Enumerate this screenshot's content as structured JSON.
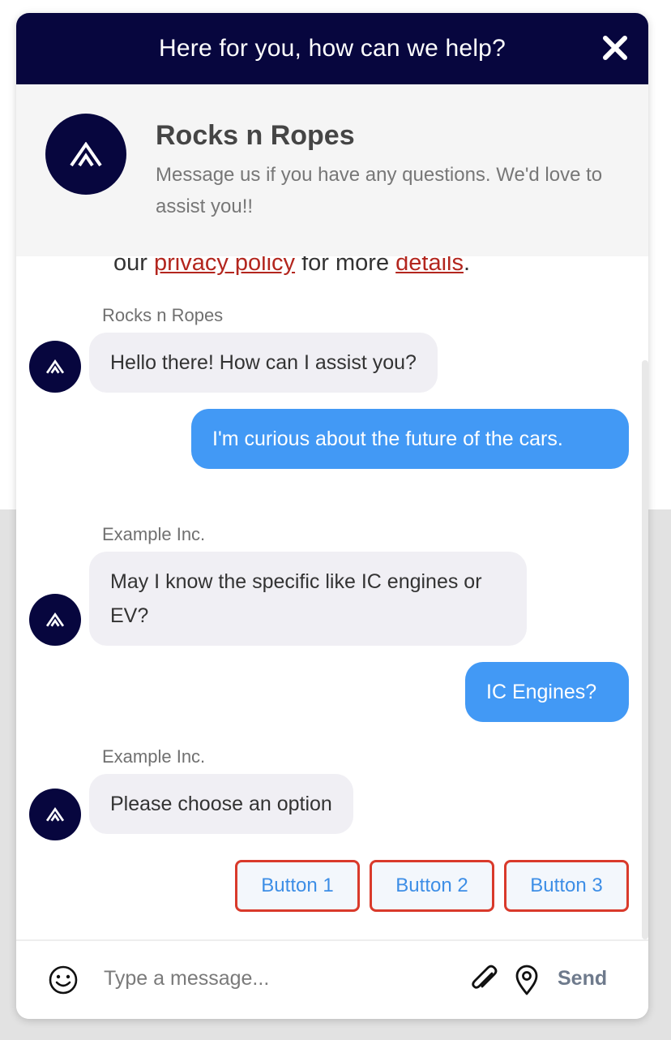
{
  "header": {
    "title": "Here for you, how can we help?"
  },
  "brand": {
    "name": "Rocks n Ropes",
    "description": "Message us if you have any questions. We'd love to assist you!!"
  },
  "privacy": {
    "prefix": "our ",
    "link1": "privacy policy",
    "middle": " for more ",
    "link2": "details",
    "suffix": "."
  },
  "messages": [
    {
      "sender": "Rocks n Ropes",
      "text": "Hello there! How can I assist you?"
    },
    {
      "sender": "",
      "text": "I'm curious about the future of the cars."
    },
    {
      "sender": "Example Inc.",
      "text": "May I know the specific like IC engines or EV?"
    },
    {
      "sender": "",
      "text": "IC Engines?"
    },
    {
      "sender": "Example Inc.",
      "text": "Please choose an option"
    }
  ],
  "options": [
    "Button 1",
    "Button 2",
    "Button 3"
  ],
  "composer": {
    "placeholder": "Type a message...",
    "send_label": "Send"
  },
  "colors": {
    "navy": "#07063e",
    "user_bubble": "#4299f5",
    "agent_bubble": "#f0eff4",
    "option_border": "#d93a2b",
    "option_text": "#3d8ee6"
  },
  "icons": {
    "close": "close-icon",
    "logo": "brand-logo-icon",
    "emoji": "emoji-icon",
    "attach": "paperclip-icon",
    "location": "location-pin-icon"
  }
}
